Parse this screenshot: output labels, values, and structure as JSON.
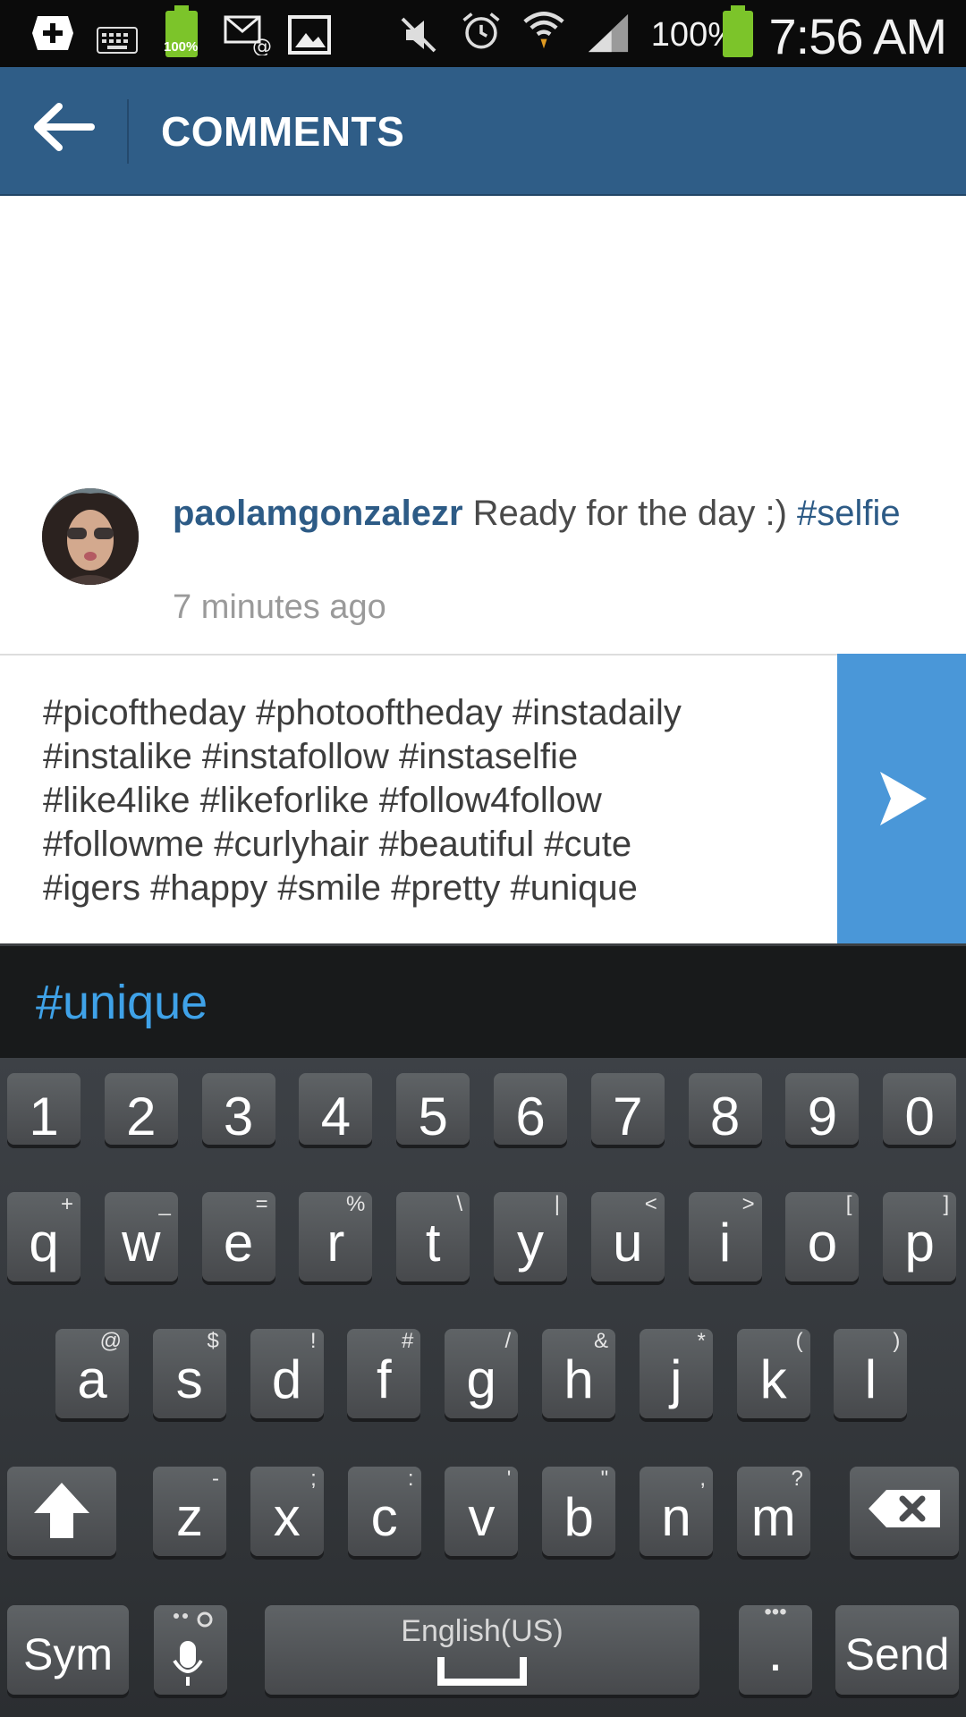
{
  "status_bar": {
    "battery_percent": "100%",
    "small_battery_label": "100%",
    "time": "7:56 AM",
    "icons": [
      "add-icon",
      "keyboard-icon",
      "battery-icon",
      "email-icon",
      "image-icon",
      "mute-icon",
      "alarm-icon",
      "wifi-icon",
      "signal-icon",
      "battery-icon"
    ]
  },
  "header": {
    "title": "COMMENTS"
  },
  "caption": {
    "username": "paolamgonzalezr",
    "text": " Ready for the day :) ",
    "hashtag": "#selfie",
    "time": "7 minutes ago"
  },
  "comment": {
    "text": "#picoftheday #photooftheday #instadaily\n#instalike #instafollow #instaselfie\n#like4like #likeforlike #follow4follow\n#followme #curlyhair #beautiful #cute\n#igers #happy #smile #pretty #unique"
  },
  "suggestion": "#unique",
  "keyboard": {
    "numbers": [
      "1",
      "2",
      "3",
      "4",
      "5",
      "6",
      "7",
      "8",
      "9",
      "0"
    ],
    "row1": [
      [
        "q",
        "+"
      ],
      [
        "w",
        "_"
      ],
      [
        "e",
        "="
      ],
      [
        "r",
        "%"
      ],
      [
        "t",
        "\\"
      ],
      [
        "y",
        "|"
      ],
      [
        "u",
        "<"
      ],
      [
        "i",
        ">"
      ],
      [
        "o",
        "["
      ],
      [
        "p",
        "]"
      ]
    ],
    "row2": [
      [
        "a",
        "@"
      ],
      [
        "s",
        "$"
      ],
      [
        "d",
        "!"
      ],
      [
        "f",
        "#"
      ],
      [
        "g",
        "/"
      ],
      [
        "h",
        "&"
      ],
      [
        "j",
        "*"
      ],
      [
        "k",
        "("
      ],
      [
        "l",
        ")"
      ]
    ],
    "row3": [
      [
        "z",
        "-"
      ],
      [
        "x",
        ";"
      ],
      [
        "c",
        ":"
      ],
      [
        "v",
        "'"
      ],
      [
        "b",
        "\""
      ],
      [
        "n",
        ","
      ],
      [
        "m",
        "?"
      ]
    ],
    "sym": "Sym",
    "space_label": "English(US)",
    "period": ".",
    "send": "Send"
  },
  "colors": {
    "header": "#2f5d87",
    "send_button": "#4a97d8",
    "link": "#2d5b86",
    "suggestion": "#3fa2e8"
  }
}
